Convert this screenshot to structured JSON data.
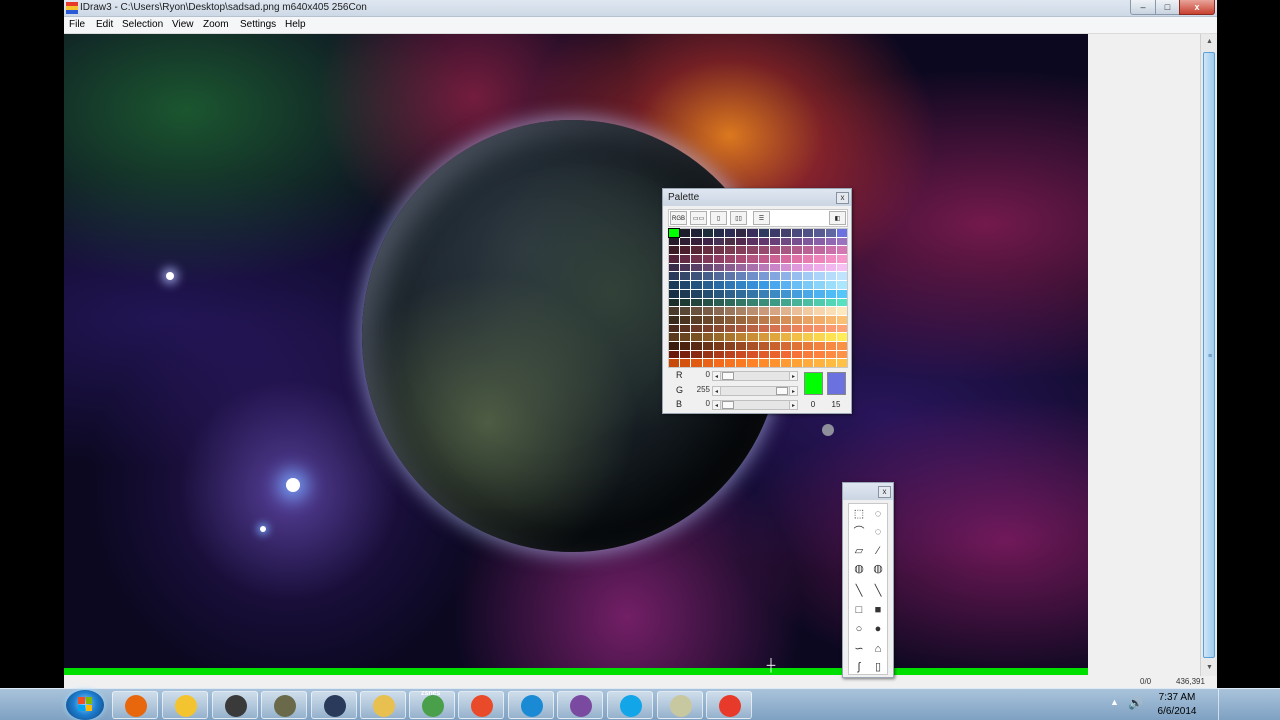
{
  "window": {
    "title": "IDraw3 - C:\\Users\\Ryon\\Desktop\\sadsad.png m640x405 256Con",
    "controls": {
      "minimize": "–",
      "maximize": "□",
      "close": "x"
    }
  },
  "menu": [
    "File",
    "Edit",
    "Selection",
    "View",
    "Zoom",
    "Settings",
    "Help"
  ],
  "statusbar": {
    "selection": "0/0",
    "coords": "436,391"
  },
  "palette": {
    "title": "Palette",
    "close": "x",
    "tools": [
      "RGB",
      "▭▭",
      "▯",
      "▯▯",
      "☰",
      "◧"
    ],
    "colors": [
      "#00ff00",
      "#1c1c2a",
      "#202036",
      "#1e2d3a",
      "#232a48",
      "#2c2c54",
      "#322a44",
      "#3a2e5c",
      "#2e3a60",
      "#3c3a6a",
      "#44406e",
      "#4a4a7c",
      "#505286",
      "#585a92",
      "#6066a0",
      "#6b72e0",
      "#241a2a",
      "#2e1e34",
      "#361f3a",
      "#3e2448",
      "#463054",
      "#4c2e46",
      "#542a50",
      "#5c3262",
      "#62386e",
      "#6a4078",
      "#704884",
      "#785090",
      "#80589c",
      "#8860a8",
      "#9068b4",
      "#9a72c0",
      "#3a1a24",
      "#4a1e2c",
      "#582636",
      "#662e40",
      "#70344a",
      "#7a3a52",
      "#843e5a",
      "#8c4464",
      "#964a6e",
      "#a05078",
      "#a85682",
      "#b25c8c",
      "#ba6296",
      "#c268a0",
      "#ca70aa",
      "#d478b4",
      "#52223a",
      "#622a44",
      "#72324e",
      "#803858",
      "#8e3e62",
      "#9c466c",
      "#a84c76",
      "#b45480",
      "#c05a8a",
      "#cc6294",
      "#d66a9e",
      "#e072a8",
      "#e87ab2",
      "#ee84bc",
      "#f28ec4",
      "#f698cc",
      "#3a2a4a",
      "#4a3458",
      "#5a3e66",
      "#6a4874",
      "#7a5282",
      "#8a5c90",
      "#9a669e",
      "#aa70ac",
      "#ba7aba",
      "#ca84c8",
      "#d48ed2",
      "#de98dc",
      "#e8a2e6",
      "#eeaceb",
      "#f2b6ef",
      "#f6c0f3",
      "#2a3a5a",
      "#34466a",
      "#3e527a",
      "#485e8a",
      "#526a9a",
      "#5c76aa",
      "#6682ba",
      "#708eca",
      "#7a9ad6",
      "#84a6e0",
      "#8eb2e8",
      "#98bef0",
      "#a2caf6",
      "#acd4fa",
      "#b6dcfc",
      "#c0e4fe",
      "#1a3a5a",
      "#1e466c",
      "#22527e",
      "#265e90",
      "#2a6aa2",
      "#2e76b4",
      "#3282c6",
      "#368ed8",
      "#3a9ae6",
      "#4aa6ee",
      "#5ab2f2",
      "#6abef6",
      "#7acaf8",
      "#8ad4fa",
      "#9adefc",
      "#aae6fe",
      "#183046",
      "#1c3a54",
      "#204462",
      "#244e70",
      "#28587e",
      "#2c628c",
      "#306c9a",
      "#3476a8",
      "#3880b6",
      "#3c8ac4",
      "#4094d2",
      "#449ede",
      "#48a8e8",
      "#4cb2f0",
      "#50bcf6",
      "#54c6fa",
      "#1a2e2a",
      "#1e3a34",
      "#22463e",
      "#265248",
      "#2a5e52",
      "#2e6a5c",
      "#327666",
      "#368270",
      "#3a8e7a",
      "#3e9a84",
      "#42a68e",
      "#46b298",
      "#4abea2",
      "#4ecaac",
      "#52d6b6",
      "#56e2c0",
      "#4a3a2a",
      "#5a4634",
      "#6a523e",
      "#7a5e48",
      "#8a6a52",
      "#9a765c",
      "#aa8266",
      "#ba8e70",
      "#ca9a7a",
      "#d6a684",
      "#e0b28e",
      "#eabe98",
      "#f2caa2",
      "#f6d4ac",
      "#fadeb6",
      "#fee8c0",
      "#3a2a1a",
      "#4a3420",
      "#5a3e26",
      "#6a482c",
      "#7a5232",
      "#8a5c38",
      "#9a663e",
      "#aa7044",
      "#ba7a4a",
      "#ca8450",
      "#d68e56",
      "#e0985c",
      "#eaa262",
      "#f2ac68",
      "#f6b66e",
      "#fac074",
      "#4a2a1a",
      "#5a3220",
      "#6a3a26",
      "#7a422c",
      "#8a4a32",
      "#9a5238",
      "#aa5a3e",
      "#ba6244",
      "#ca6a4a",
      "#d67250",
      "#e07a56",
      "#ea825c",
      "#f28a62",
      "#f69268",
      "#fa9a6e",
      "#fea274",
      "#5a3a1a",
      "#6a461e",
      "#7a5222",
      "#8a5e26",
      "#9a6a2a",
      "#aa762e",
      "#ba8232",
      "#ca8e36",
      "#d69a3a",
      "#e0a63e",
      "#eab242",
      "#f2be46",
      "#f6ca4a",
      "#fad64e",
      "#fee252",
      "#ffec56",
      "#3a1a0a",
      "#4a220e",
      "#5a2a12",
      "#6a3216",
      "#7a3a1a",
      "#8a421e",
      "#9a4a22",
      "#aa5226",
      "#ba5a2a",
      "#ca622e",
      "#d66a32",
      "#e07236",
      "#ea7a3a",
      "#f2823e",
      "#f68a42",
      "#fa9246",
      "#6a1a0a",
      "#7a220e",
      "#8a2a12",
      "#9a3216",
      "#aa3a1a",
      "#ba421e",
      "#ca4a22",
      "#d65226",
      "#e05a2a",
      "#ea622e",
      "#f26a32",
      "#f67236",
      "#fa7a3a",
      "#fe823e",
      "#ff8a42",
      "#ff9246",
      "#c84a0a",
      "#d4520e",
      "#e05a12",
      "#ea6216",
      "#f26a1a",
      "#f6721e",
      "#fa7a22",
      "#fe8226",
      "#ff8a2a",
      "#ff922e",
      "#ff9a32",
      "#ffa236",
      "#ffaa3a",
      "#ffb23e",
      "#ffba42",
      "#ffc246"
    ],
    "channels": [
      {
        "label": "R",
        "value": "0",
        "fraction": 0
      },
      {
        "label": "G",
        "value": "255",
        "fraction": 1
      },
      {
        "label": "B",
        "value": "0",
        "fraction": 0
      }
    ],
    "fg_index": "0",
    "bg_index": "15",
    "fg_color": "#00ff00",
    "bg_color": "#6b72e0"
  },
  "toolbox": {
    "close": "x",
    "tools": [
      {
        "name": "rect-select-tool-icon",
        "glyph": "⬚"
      },
      {
        "name": "ellipse-select-tool-icon",
        "glyph": "◌"
      },
      {
        "name": "freehand-select-tool-icon",
        "glyph": "⌒"
      },
      {
        "name": "lasso-select-tool-icon",
        "glyph": "◌"
      },
      {
        "name": "polygon-select-tool-icon",
        "glyph": "▱"
      },
      {
        "name": "eyedropper-tool-icon",
        "glyph": "⁄"
      },
      {
        "name": "fill-tool-icon",
        "glyph": "◍"
      },
      {
        "name": "airbrush-tool-icon",
        "glyph": "◍"
      },
      {
        "name": "pencil-tool-icon",
        "glyph": "╲"
      },
      {
        "name": "line-tool-icon",
        "glyph": "╲"
      },
      {
        "name": "rectangle-tool-icon",
        "glyph": "□"
      },
      {
        "name": "filled-rectangle-tool-icon",
        "glyph": "■"
      },
      {
        "name": "ellipse-tool-icon",
        "glyph": "○"
      },
      {
        "name": "filled-ellipse-tool-icon",
        "glyph": "●"
      },
      {
        "name": "curve-tool-icon",
        "glyph": "∽"
      },
      {
        "name": "bucket-tool-icon",
        "glyph": "⌂"
      },
      {
        "name": "smudge-tool-icon",
        "glyph": "ʃ"
      },
      {
        "name": "eraser-tool-icon",
        "glyph": "▯"
      }
    ]
  },
  "taskbar": {
    "apps": [
      {
        "name": "firefox-icon",
        "color": "#e8660c"
      },
      {
        "name": "game-launcher-icon",
        "color": "#f4c430"
      },
      {
        "name": "camera-icon",
        "color": "#3a3a3a"
      },
      {
        "name": "emulator-icon",
        "color": "#6a6a4a"
      },
      {
        "name": "steam-icon",
        "color": "#2a3a5a"
      },
      {
        "name": "file-explorer-icon",
        "color": "#e8c050"
      },
      {
        "name": "zsnes-icon",
        "color": "#4aa04a"
      },
      {
        "name": "star-app-icon",
        "color": "#e84a2a"
      },
      {
        "name": "maxthon-icon",
        "color": "#1a8ad4"
      },
      {
        "name": "gamepad-icon",
        "color": "#7a4aa0"
      },
      {
        "name": "skype-icon",
        "color": "#12a5e8"
      },
      {
        "name": "paint-icon",
        "color": "#c8c8a0"
      },
      {
        "name": "idraw-icon",
        "color": "#e83a2a"
      }
    ],
    "zsnes_label": "zsnes",
    "clock_time": "7:37 AM",
    "clock_date": "6/6/2014"
  }
}
